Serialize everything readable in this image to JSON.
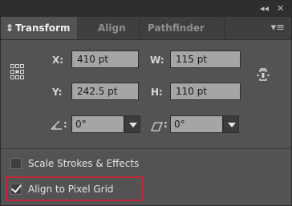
{
  "window": {
    "collapse_glyph": "◂◂",
    "close_glyph": "✕"
  },
  "tabs": [
    {
      "label": "Transform",
      "active": true,
      "prefix_glyph": "⇕"
    },
    {
      "label": "Align",
      "active": false
    },
    {
      "label": "Pathfinder",
      "active": false
    }
  ],
  "panel_menu_glyph": "▾≡",
  "transform": {
    "x": {
      "label": "X:",
      "value": "410 pt"
    },
    "y": {
      "label": "Y:",
      "value": "242.5 pt"
    },
    "w": {
      "label": "W:",
      "value": "115 pt"
    },
    "h": {
      "label": "H:",
      "value": "110 pt"
    },
    "rotate": {
      "value": "0°",
      "icon": "rotate-angle-icon"
    },
    "shear": {
      "value": "0°",
      "icon": "shear-icon"
    },
    "reference_point_icon": "reference-point-grid-icon",
    "constrain_icon": "link-proportions-icon"
  },
  "options": {
    "scale_strokes": {
      "label": "Scale Strokes & Effects",
      "checked": false
    },
    "align_pixel": {
      "label": "Align to Pixel Grid",
      "checked": true
    }
  },
  "colors": {
    "panel_bg": "#535353",
    "field_bg": "#a5a5a5",
    "highlight": "#c0283a"
  }
}
